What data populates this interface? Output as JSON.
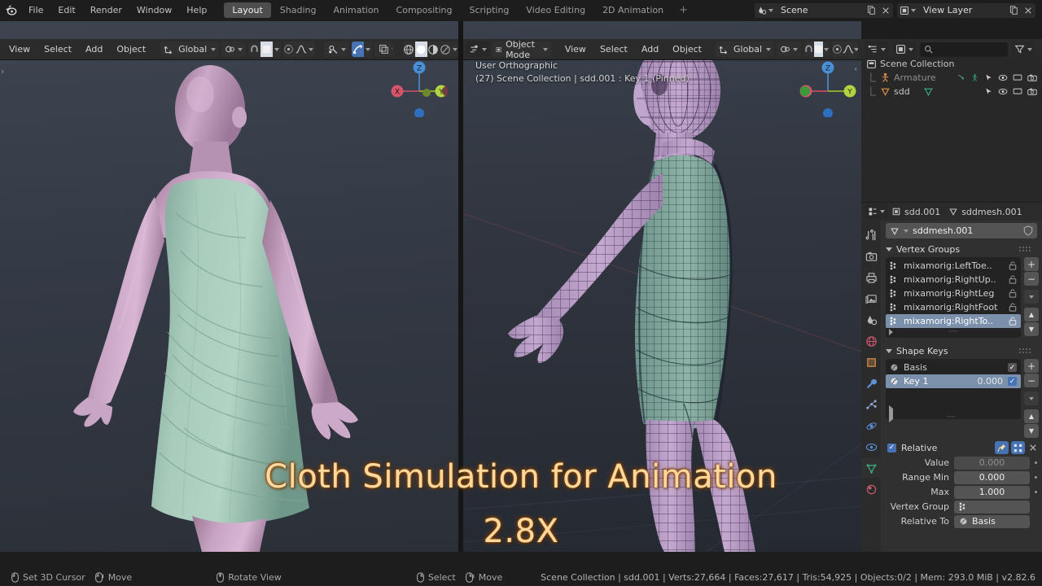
{
  "app": {
    "name": "Blender",
    "version_label": "v2.82.6"
  },
  "topbar": {
    "logo_icon": "blender-logo-icon",
    "menus": [
      "File",
      "Edit",
      "Render",
      "Window",
      "Help"
    ],
    "workspace_tabs": [
      {
        "label": "Layout",
        "active": true
      },
      {
        "label": "Shading",
        "active": false
      },
      {
        "label": "Animation",
        "active": false
      },
      {
        "label": "Compositing",
        "active": false
      },
      {
        "label": "Scripting",
        "active": false
      },
      {
        "label": "Video Editing",
        "active": false
      },
      {
        "label": "2D Animation",
        "active": false
      }
    ],
    "add_workspace_label": "+",
    "scene": {
      "icon": "scene-icon",
      "value": "Scene",
      "new_icon": "duplicate-icon",
      "unlink_icon": "x-icon"
    },
    "view_layer": {
      "icon": "view-layer-icon",
      "value": "View Layer",
      "new_icon": "duplicate-icon",
      "unlink_icon": "x-icon"
    }
  },
  "viewport_left": {
    "editor_icon": "editor-type-icon",
    "menus": [
      "View",
      "Select",
      "Add",
      "Object"
    ],
    "transform_orientation": "Global",
    "snap_icon": "magnet-icon",
    "pivot_icon": "pivot-icon",
    "proportional_icon": "proportional-edit-icon",
    "falloff_icon": "smooth-falloff-icon",
    "shading_modes": [
      "wireframe",
      "solid",
      "material-preview",
      "rendered"
    ],
    "shading_active": "solid",
    "xray_icon": "xray-icon",
    "gizmo_axes": [
      {
        "label": "X",
        "color": "#d4566b"
      },
      {
        "label": "Y",
        "color": "#b2d442"
      },
      {
        "label": "Z",
        "color": "#4a8fd4"
      }
    ]
  },
  "viewport_right": {
    "mode_icon": "edit-mode-icon",
    "mode": "Object Mode",
    "menus": [
      "View",
      "Select",
      "Add",
      "Object"
    ],
    "transform_orientation": "Global",
    "overlay_line_1": "User Orthographic",
    "overlay_line_2": "(27) Scene Collection | sdd.001 : Key 1 (Pinned)"
  },
  "overlay": {
    "title_line_1": "Cloth Simulation for Animation",
    "title_line_2": "2.8X",
    "color": "#fcd9a0"
  },
  "outliner": {
    "display_mode_icon": "outliner-display-icon",
    "filter_icon": "view-layer-icon",
    "search_placeholder": "",
    "search_icon": "search-icon",
    "funnel_icon": "filter-funnel-icon",
    "rows": [
      {
        "label": "Scene Collection",
        "icon": "collection-icon",
        "indent": 0,
        "dim": false,
        "restrict": []
      },
      {
        "label": "Armature",
        "icon": "armature-icon",
        "indent": 1,
        "dim": true,
        "restrict": [
          "modifier-icon",
          "pose-icon",
          "cursor-icon",
          "eye-icon",
          "screen-icon",
          "camera-icon"
        ]
      },
      {
        "label": "sdd",
        "icon": "mesh-object-icon",
        "indent": 1,
        "dim": false,
        "restrict": [
          "mesh-data-icon",
          "cursor-icon",
          "eye-icon",
          "screen-icon",
          "camera-icon"
        ]
      }
    ]
  },
  "properties": {
    "tabs": [
      {
        "name": "tool-tab",
        "icon": "tool-icon",
        "active": false
      },
      {
        "name": "render-tab",
        "icon": "camera-back-icon",
        "active": false
      },
      {
        "name": "output-tab",
        "icon": "printer-icon",
        "active": false
      },
      {
        "name": "view-layer-tab",
        "icon": "images-icon",
        "active": false
      },
      {
        "name": "scene-tab",
        "icon": "scene-cone-icon",
        "active": false
      },
      {
        "name": "world-tab",
        "icon": "world-icon",
        "active": false
      },
      {
        "name": "object-tab",
        "icon": "object-square-icon",
        "active": false
      },
      {
        "name": "modifier-tab",
        "icon": "wrench-icon",
        "active": false
      },
      {
        "name": "particles-tab",
        "icon": "particles-icon",
        "active": false
      },
      {
        "name": "physics-tab",
        "icon": "physics-orbit-icon",
        "active": false
      },
      {
        "name": "constraints-tab",
        "icon": "constraint-icon",
        "active": false
      },
      {
        "name": "data-tab",
        "icon": "mesh-data-triangle-icon",
        "active": true
      },
      {
        "name": "material-tab",
        "icon": "material-sphere-icon",
        "active": false
      }
    ],
    "breadcrumb": {
      "editor_icon": "properties-editor-icon",
      "object_icon": "object-square-icon",
      "object_name": "sdd.001",
      "data_icon": "mesh-data-triangle-icon",
      "data_name": "sddmesh.001"
    },
    "name_field": {
      "icon": "mesh-data-triangle-icon",
      "value": "sddmesh.001",
      "shield_icon": "fake-user-icon"
    },
    "vertex_groups": {
      "title": "Vertex Groups",
      "items": [
        {
          "label": "mixamorig:LeftToe..",
          "selected": false,
          "lock_icon": "unlocked-icon"
        },
        {
          "label": "mixamorig:RightUp..",
          "selected": false,
          "lock_icon": "unlocked-icon"
        },
        {
          "label": "mixamorig:RightLeg",
          "selected": false,
          "lock_icon": "unlocked-icon"
        },
        {
          "label": "mixamorig:RightFoot",
          "selected": false,
          "lock_icon": "unlocked-icon"
        },
        {
          "label": "mixamorig:RightTo..",
          "selected": true,
          "lock_icon": "unlocked-icon"
        }
      ],
      "buttons": [
        "+",
        "−",
        "⌄",
        "▲",
        "▼"
      ]
    },
    "shape_keys": {
      "title": "Shape Keys",
      "columns": [
        "name",
        "value",
        "mute"
      ],
      "items": [
        {
          "label": "Basis",
          "value": "",
          "selected": false,
          "enabled": true
        },
        {
          "label": "Key 1",
          "value": "0.000",
          "selected": true,
          "enabled": true
        }
      ],
      "buttons": [
        "+",
        "−",
        "⌄",
        "▲",
        "▼"
      ],
      "relative_label": "Relative",
      "relative_checked": true,
      "pin_icon": "pin-icon",
      "edit_mode_icon": "shape-key-edit-icon",
      "close_icon": "x-icon",
      "fields": [
        {
          "label": "Value",
          "value": "0.000",
          "disabled": true
        },
        {
          "label": "Range Min",
          "value": "0.000",
          "disabled": false
        },
        {
          "label": "Max",
          "value": "1.000",
          "disabled": false
        },
        {
          "label": "Vertex Group",
          "value": "",
          "icon": "vertex-group-icon",
          "disabled": false
        },
        {
          "label": "Relative To",
          "value": "Basis",
          "icon": "shape-key-icon",
          "disabled": false
        }
      ]
    }
  },
  "statusbar": {
    "keymap": [
      {
        "mouse": "left",
        "label": "Set 3D Cursor"
      },
      {
        "mouse": "left-drag",
        "label": "Move"
      },
      {
        "mouse": "middle",
        "label": "Rotate View"
      },
      {
        "mouse": "right",
        "label": "Select"
      },
      {
        "mouse": "right-drag",
        "label": "Move"
      }
    ],
    "stats": "Scene Collection | sdd.001 | Verts:27,664 | Faces:27,617 | Tris:54,925 | Objects:0/2 | Mem: 293.0 MiB | v2.82.6"
  }
}
